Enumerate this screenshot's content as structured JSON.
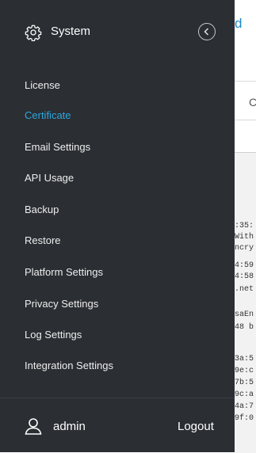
{
  "background": {
    "partial_title": "d",
    "partial_tab": "C",
    "code_lines": [
      ":35:",
      "With",
      "ncry",
      "4:59",
      "4:58",
      ".net",
      "saEn",
      "48 b",
      "3a:5",
      "9e:c",
      "7b:5",
      "9c:a",
      "4a:7",
      "9f:0"
    ]
  },
  "drawer": {
    "title": "System",
    "menu": [
      {
        "label": "License",
        "active": false
      },
      {
        "label": "Certificate",
        "active": true
      },
      {
        "label": "Email Settings",
        "active": false
      },
      {
        "label": "API Usage",
        "active": false
      },
      {
        "label": "Backup",
        "active": false
      },
      {
        "label": "Restore",
        "active": false
      },
      {
        "label": "Platform Settings",
        "active": false
      },
      {
        "label": "Privacy Settings",
        "active": false
      },
      {
        "label": "Log Settings",
        "active": false
      },
      {
        "label": "Integration Settings",
        "active": false
      }
    ],
    "footer": {
      "user": "admin",
      "logout_label": "Logout"
    }
  },
  "colors": {
    "drawer_bg": "#2b2e33",
    "active": "#2ba8e0",
    "link": "#1e88c8"
  }
}
